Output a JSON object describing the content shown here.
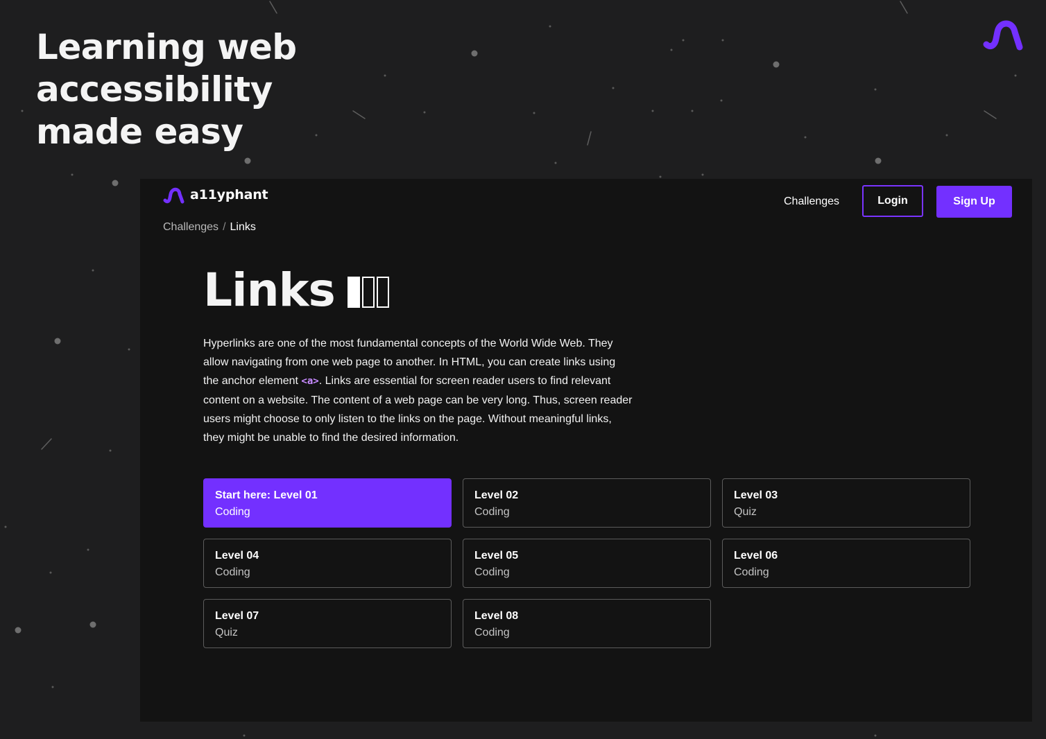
{
  "tagline": [
    "Learning web",
    "accessibility",
    "made easy"
  ],
  "brand": {
    "name": "a11yphant",
    "accent": "#7330ff"
  },
  "nav": {
    "challenges": "Challenges",
    "login": "Login",
    "signup": "Sign Up"
  },
  "breadcrumb": {
    "parent": "Challenges",
    "separator": "/",
    "current": "Links"
  },
  "challenge": {
    "title": "Links",
    "difficulty_level": 1,
    "difficulty_max": 3,
    "intro": {
      "before": "Hyperlinks are one of the most fundamental concepts of the World Wide Web. They allow navigating from one web page to another. In HTML, you can create links using the anchor element ",
      "code": "<a>",
      "after": ". Links are essential for screen reader users to find relevant content on a website. The content of a web page can be very long. Thus, screen reader users might choose to only listen to the links on the page. Without meaningful links, they might be unable to find the desired information."
    }
  },
  "levels": [
    {
      "name": "Start here: Level 01",
      "type": "Coding",
      "active": true
    },
    {
      "name": "Level 02",
      "type": "Coding"
    },
    {
      "name": "Level 03",
      "type": "Quiz"
    },
    {
      "name": "Level 04",
      "type": "Coding"
    },
    {
      "name": "Level 05",
      "type": "Coding"
    },
    {
      "name": "Level 06",
      "type": "Coding"
    },
    {
      "name": "Level 07",
      "type": "Quiz"
    },
    {
      "name": "Level 08",
      "type": "Coding"
    }
  ]
}
